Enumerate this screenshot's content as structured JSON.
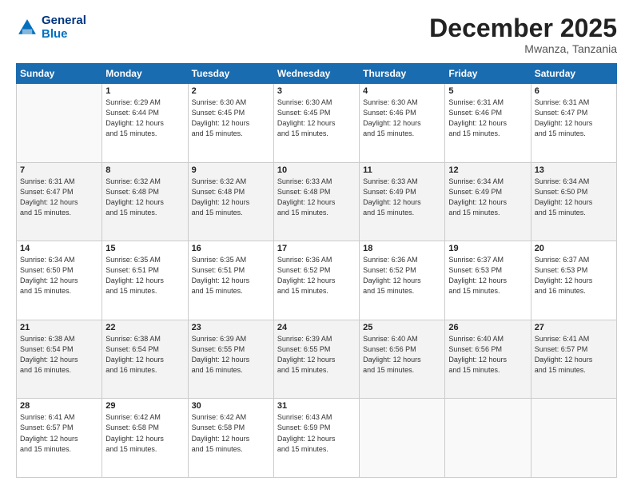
{
  "header": {
    "logo_line1": "General",
    "logo_line2": "Blue",
    "month": "December 2025",
    "location": "Mwanza, Tanzania"
  },
  "weekdays": [
    "Sunday",
    "Monday",
    "Tuesday",
    "Wednesday",
    "Thursday",
    "Friday",
    "Saturday"
  ],
  "weeks": [
    [
      {
        "day": "",
        "info": ""
      },
      {
        "day": "1",
        "info": "Sunrise: 6:29 AM\nSunset: 6:44 PM\nDaylight: 12 hours\nand 15 minutes."
      },
      {
        "day": "2",
        "info": "Sunrise: 6:30 AM\nSunset: 6:45 PM\nDaylight: 12 hours\nand 15 minutes."
      },
      {
        "day": "3",
        "info": "Sunrise: 6:30 AM\nSunset: 6:45 PM\nDaylight: 12 hours\nand 15 minutes."
      },
      {
        "day": "4",
        "info": "Sunrise: 6:30 AM\nSunset: 6:46 PM\nDaylight: 12 hours\nand 15 minutes."
      },
      {
        "day": "5",
        "info": "Sunrise: 6:31 AM\nSunset: 6:46 PM\nDaylight: 12 hours\nand 15 minutes."
      },
      {
        "day": "6",
        "info": "Sunrise: 6:31 AM\nSunset: 6:47 PM\nDaylight: 12 hours\nand 15 minutes."
      }
    ],
    [
      {
        "day": "7",
        "info": "Sunrise: 6:31 AM\nSunset: 6:47 PM\nDaylight: 12 hours\nand 15 minutes."
      },
      {
        "day": "8",
        "info": "Sunrise: 6:32 AM\nSunset: 6:48 PM\nDaylight: 12 hours\nand 15 minutes."
      },
      {
        "day": "9",
        "info": "Sunrise: 6:32 AM\nSunset: 6:48 PM\nDaylight: 12 hours\nand 15 minutes."
      },
      {
        "day": "10",
        "info": "Sunrise: 6:33 AM\nSunset: 6:48 PM\nDaylight: 12 hours\nand 15 minutes."
      },
      {
        "day": "11",
        "info": "Sunrise: 6:33 AM\nSunset: 6:49 PM\nDaylight: 12 hours\nand 15 minutes."
      },
      {
        "day": "12",
        "info": "Sunrise: 6:34 AM\nSunset: 6:49 PM\nDaylight: 12 hours\nand 15 minutes."
      },
      {
        "day": "13",
        "info": "Sunrise: 6:34 AM\nSunset: 6:50 PM\nDaylight: 12 hours\nand 15 minutes."
      }
    ],
    [
      {
        "day": "14",
        "info": "Sunrise: 6:34 AM\nSunset: 6:50 PM\nDaylight: 12 hours\nand 15 minutes."
      },
      {
        "day": "15",
        "info": "Sunrise: 6:35 AM\nSunset: 6:51 PM\nDaylight: 12 hours\nand 15 minutes."
      },
      {
        "day": "16",
        "info": "Sunrise: 6:35 AM\nSunset: 6:51 PM\nDaylight: 12 hours\nand 15 minutes."
      },
      {
        "day": "17",
        "info": "Sunrise: 6:36 AM\nSunset: 6:52 PM\nDaylight: 12 hours\nand 15 minutes."
      },
      {
        "day": "18",
        "info": "Sunrise: 6:36 AM\nSunset: 6:52 PM\nDaylight: 12 hours\nand 15 minutes."
      },
      {
        "day": "19",
        "info": "Sunrise: 6:37 AM\nSunset: 6:53 PM\nDaylight: 12 hours\nand 15 minutes."
      },
      {
        "day": "20",
        "info": "Sunrise: 6:37 AM\nSunset: 6:53 PM\nDaylight: 12 hours\nand 16 minutes."
      }
    ],
    [
      {
        "day": "21",
        "info": "Sunrise: 6:38 AM\nSunset: 6:54 PM\nDaylight: 12 hours\nand 16 minutes."
      },
      {
        "day": "22",
        "info": "Sunrise: 6:38 AM\nSunset: 6:54 PM\nDaylight: 12 hours\nand 16 minutes."
      },
      {
        "day": "23",
        "info": "Sunrise: 6:39 AM\nSunset: 6:55 PM\nDaylight: 12 hours\nand 16 minutes."
      },
      {
        "day": "24",
        "info": "Sunrise: 6:39 AM\nSunset: 6:55 PM\nDaylight: 12 hours\nand 15 minutes."
      },
      {
        "day": "25",
        "info": "Sunrise: 6:40 AM\nSunset: 6:56 PM\nDaylight: 12 hours\nand 15 minutes."
      },
      {
        "day": "26",
        "info": "Sunrise: 6:40 AM\nSunset: 6:56 PM\nDaylight: 12 hours\nand 15 minutes."
      },
      {
        "day": "27",
        "info": "Sunrise: 6:41 AM\nSunset: 6:57 PM\nDaylight: 12 hours\nand 15 minutes."
      }
    ],
    [
      {
        "day": "28",
        "info": "Sunrise: 6:41 AM\nSunset: 6:57 PM\nDaylight: 12 hours\nand 15 minutes."
      },
      {
        "day": "29",
        "info": "Sunrise: 6:42 AM\nSunset: 6:58 PM\nDaylight: 12 hours\nand 15 minutes."
      },
      {
        "day": "30",
        "info": "Sunrise: 6:42 AM\nSunset: 6:58 PM\nDaylight: 12 hours\nand 15 minutes."
      },
      {
        "day": "31",
        "info": "Sunrise: 6:43 AM\nSunset: 6:59 PM\nDaylight: 12 hours\nand 15 minutes."
      },
      {
        "day": "",
        "info": ""
      },
      {
        "day": "",
        "info": ""
      },
      {
        "day": "",
        "info": ""
      }
    ]
  ]
}
